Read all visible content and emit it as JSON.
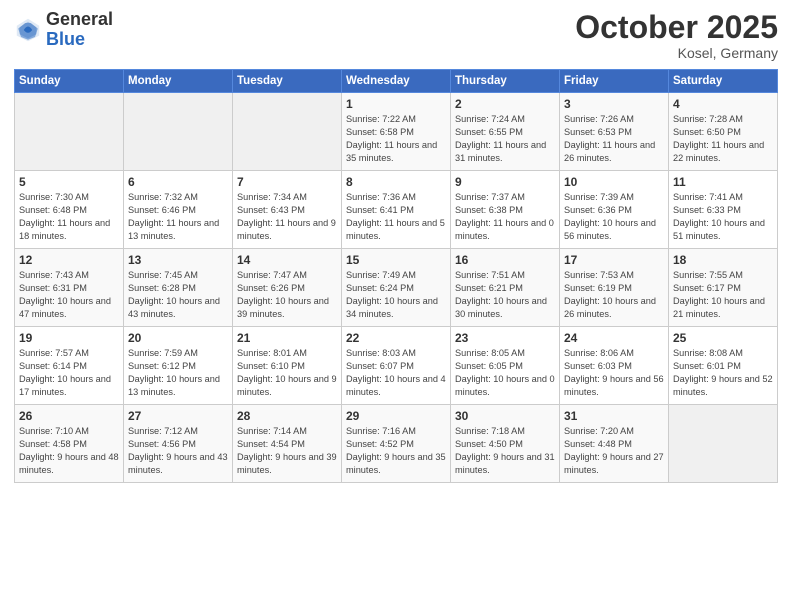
{
  "logo": {
    "general": "General",
    "blue": "Blue"
  },
  "header": {
    "month": "October 2025",
    "location": "Kosel, Germany"
  },
  "weekdays": [
    "Sunday",
    "Monday",
    "Tuesday",
    "Wednesday",
    "Thursday",
    "Friday",
    "Saturday"
  ],
  "weeks": [
    [
      {
        "day": "",
        "info": ""
      },
      {
        "day": "",
        "info": ""
      },
      {
        "day": "",
        "info": ""
      },
      {
        "day": "1",
        "info": "Sunrise: 7:22 AM\nSunset: 6:58 PM\nDaylight: 11 hours and 35 minutes."
      },
      {
        "day": "2",
        "info": "Sunrise: 7:24 AM\nSunset: 6:55 PM\nDaylight: 11 hours and 31 minutes."
      },
      {
        "day": "3",
        "info": "Sunrise: 7:26 AM\nSunset: 6:53 PM\nDaylight: 11 hours and 26 minutes."
      },
      {
        "day": "4",
        "info": "Sunrise: 7:28 AM\nSunset: 6:50 PM\nDaylight: 11 hours and 22 minutes."
      }
    ],
    [
      {
        "day": "5",
        "info": "Sunrise: 7:30 AM\nSunset: 6:48 PM\nDaylight: 11 hours and 18 minutes."
      },
      {
        "day": "6",
        "info": "Sunrise: 7:32 AM\nSunset: 6:46 PM\nDaylight: 11 hours and 13 minutes."
      },
      {
        "day": "7",
        "info": "Sunrise: 7:34 AM\nSunset: 6:43 PM\nDaylight: 11 hours and 9 minutes."
      },
      {
        "day": "8",
        "info": "Sunrise: 7:36 AM\nSunset: 6:41 PM\nDaylight: 11 hours and 5 minutes."
      },
      {
        "day": "9",
        "info": "Sunrise: 7:37 AM\nSunset: 6:38 PM\nDaylight: 11 hours and 0 minutes."
      },
      {
        "day": "10",
        "info": "Sunrise: 7:39 AM\nSunset: 6:36 PM\nDaylight: 10 hours and 56 minutes."
      },
      {
        "day": "11",
        "info": "Sunrise: 7:41 AM\nSunset: 6:33 PM\nDaylight: 10 hours and 51 minutes."
      }
    ],
    [
      {
        "day": "12",
        "info": "Sunrise: 7:43 AM\nSunset: 6:31 PM\nDaylight: 10 hours and 47 minutes."
      },
      {
        "day": "13",
        "info": "Sunrise: 7:45 AM\nSunset: 6:28 PM\nDaylight: 10 hours and 43 minutes."
      },
      {
        "day": "14",
        "info": "Sunrise: 7:47 AM\nSunset: 6:26 PM\nDaylight: 10 hours and 39 minutes."
      },
      {
        "day": "15",
        "info": "Sunrise: 7:49 AM\nSunset: 6:24 PM\nDaylight: 10 hours and 34 minutes."
      },
      {
        "day": "16",
        "info": "Sunrise: 7:51 AM\nSunset: 6:21 PM\nDaylight: 10 hours and 30 minutes."
      },
      {
        "day": "17",
        "info": "Sunrise: 7:53 AM\nSunset: 6:19 PM\nDaylight: 10 hours and 26 minutes."
      },
      {
        "day": "18",
        "info": "Sunrise: 7:55 AM\nSunset: 6:17 PM\nDaylight: 10 hours and 21 minutes."
      }
    ],
    [
      {
        "day": "19",
        "info": "Sunrise: 7:57 AM\nSunset: 6:14 PM\nDaylight: 10 hours and 17 minutes."
      },
      {
        "day": "20",
        "info": "Sunrise: 7:59 AM\nSunset: 6:12 PM\nDaylight: 10 hours and 13 minutes."
      },
      {
        "day": "21",
        "info": "Sunrise: 8:01 AM\nSunset: 6:10 PM\nDaylight: 10 hours and 9 minutes."
      },
      {
        "day": "22",
        "info": "Sunrise: 8:03 AM\nSunset: 6:07 PM\nDaylight: 10 hours and 4 minutes."
      },
      {
        "day": "23",
        "info": "Sunrise: 8:05 AM\nSunset: 6:05 PM\nDaylight: 10 hours and 0 minutes."
      },
      {
        "day": "24",
        "info": "Sunrise: 8:06 AM\nSunset: 6:03 PM\nDaylight: 9 hours and 56 minutes."
      },
      {
        "day": "25",
        "info": "Sunrise: 8:08 AM\nSunset: 6:01 PM\nDaylight: 9 hours and 52 minutes."
      }
    ],
    [
      {
        "day": "26",
        "info": "Sunrise: 7:10 AM\nSunset: 4:58 PM\nDaylight: 9 hours and 48 minutes."
      },
      {
        "day": "27",
        "info": "Sunrise: 7:12 AM\nSunset: 4:56 PM\nDaylight: 9 hours and 43 minutes."
      },
      {
        "day": "28",
        "info": "Sunrise: 7:14 AM\nSunset: 4:54 PM\nDaylight: 9 hours and 39 minutes."
      },
      {
        "day": "29",
        "info": "Sunrise: 7:16 AM\nSunset: 4:52 PM\nDaylight: 9 hours and 35 minutes."
      },
      {
        "day": "30",
        "info": "Sunrise: 7:18 AM\nSunset: 4:50 PM\nDaylight: 9 hours and 31 minutes."
      },
      {
        "day": "31",
        "info": "Sunrise: 7:20 AM\nSunset: 4:48 PM\nDaylight: 9 hours and 27 minutes."
      },
      {
        "day": "",
        "info": ""
      }
    ]
  ]
}
